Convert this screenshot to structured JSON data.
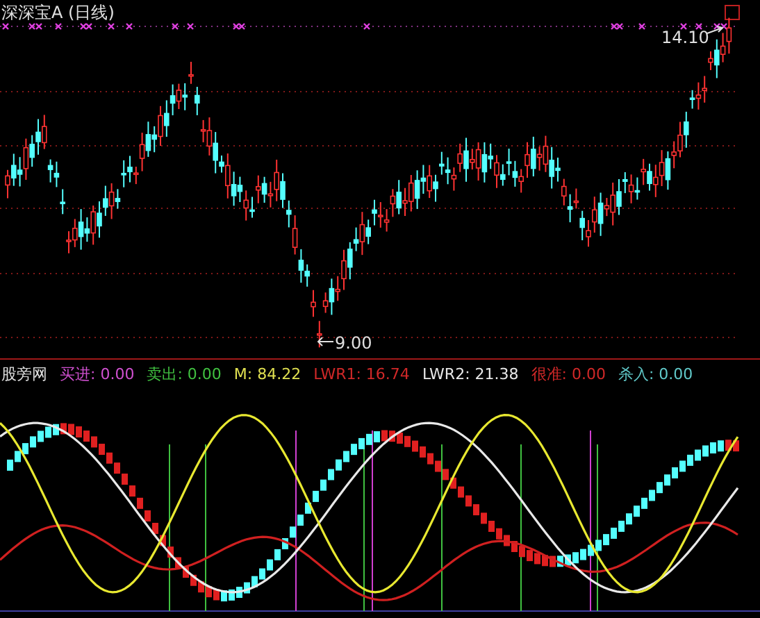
{
  "chart": {
    "title": "深深宝A (日线)",
    "high_label": "14.10",
    "low_label": "9.00"
  },
  "indicator": {
    "name": "股旁网",
    "readings": [
      {
        "text": "买进: 0.00",
        "color": "#d050d0"
      },
      {
        "text": "卖出: 0.00",
        "color": "#40c040"
      },
      {
        "text": "M: 84.22",
        "color": "#e0e050"
      },
      {
        "text": "LWR1: 16.74",
        "color": "#d02828"
      },
      {
        "text": "LWR2: 21.38",
        "color": "#e8e8e8"
      },
      {
        "text": "很准: 0.00",
        "color": "#d02828"
      },
      {
        "text": "杀入: 0.00",
        "color": "#60c8c8"
      }
    ]
  }
}
